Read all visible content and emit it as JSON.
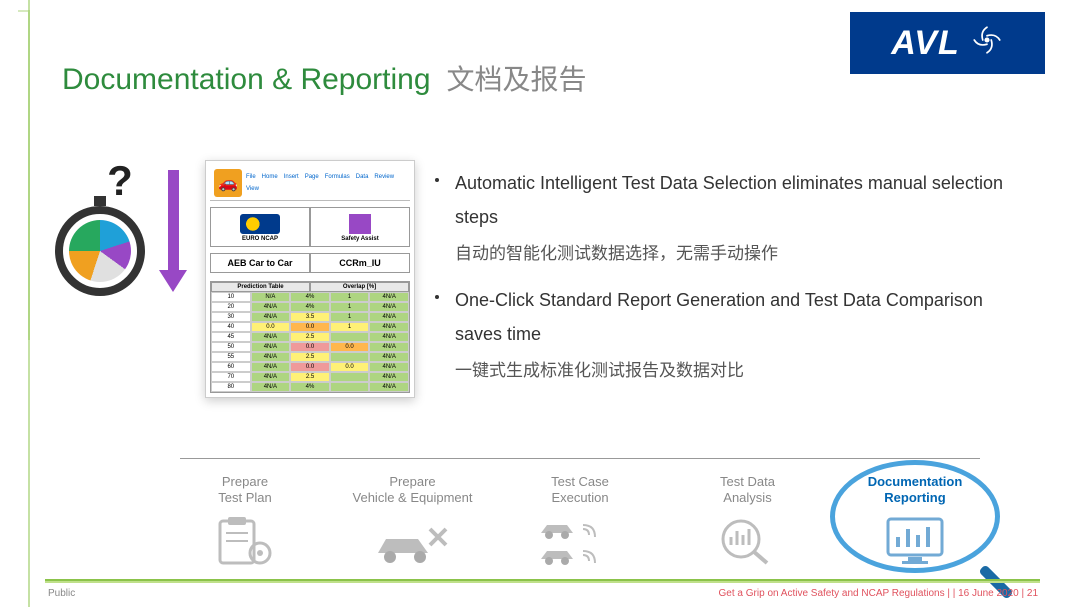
{
  "logo": {
    "text": "AVL"
  },
  "title": {
    "en": "Documentation & Reporting",
    "zh": "文档及报告"
  },
  "stopwatch": {
    "question_mark": "?"
  },
  "app_screenshot": {
    "header_left_label": "AEB Car to Car",
    "header_right_label": "CCRm_IU",
    "ncap_text": "EURO NCAP",
    "safety_text": "Safety Assist",
    "table_header_left": "Prediction Table",
    "table_header_right": "Overlap [%]"
  },
  "bullets": [
    {
      "en": "Automatic Intelligent Test Data Selection eliminates manual selection steps",
      "zh": "自动的智能化测试数据选择，无需手动操作"
    },
    {
      "en": "One-Click Standard Report Generation and Test Data Comparison saves time",
      "zh": "一键式生成标准化测试报告及数据对比"
    }
  ],
  "workflow": [
    {
      "line1": "Prepare",
      "line2": "Test Plan"
    },
    {
      "line1": "Prepare",
      "line2": "Vehicle & Equipment"
    },
    {
      "line1": "Test Case",
      "line2": "Execution"
    },
    {
      "line1": "Test Data",
      "line2": "Analysis"
    },
    {
      "line1": "Documentation",
      "line2": "Reporting"
    }
  ],
  "footer": {
    "left": "Public",
    "right": "Get a Grip on Active Safety and NCAP Regulations | | 16 June 2020 | 21"
  }
}
